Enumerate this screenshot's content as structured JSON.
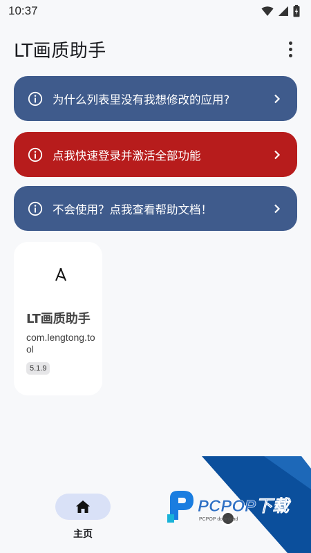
{
  "status_bar": {
    "time": "10:37"
  },
  "app_bar": {
    "title": "LT画质助手"
  },
  "banners": [
    {
      "text": "为什么列表里没有我想修改的应用?",
      "color": "#3f5b8c"
    },
    {
      "text": "点我快速登录并激活全部功能",
      "color": "#b71c1c"
    },
    {
      "text": "不会使用？点我查看帮助文档！",
      "color": "#3f5b8c"
    }
  ],
  "app_card": {
    "name": "LT画质助手",
    "package": "com.lengtong.tool",
    "version": "5.1.9"
  },
  "bottom_nav": {
    "home_label": "主页"
  },
  "watermark": {
    "brand": "PCPOP下载",
    "sub": "PCPOP download"
  },
  "colors": {
    "background": "#f7f8fa",
    "nav_active": "#d9e1f7",
    "watermark_blue": "#0b4f9c"
  }
}
